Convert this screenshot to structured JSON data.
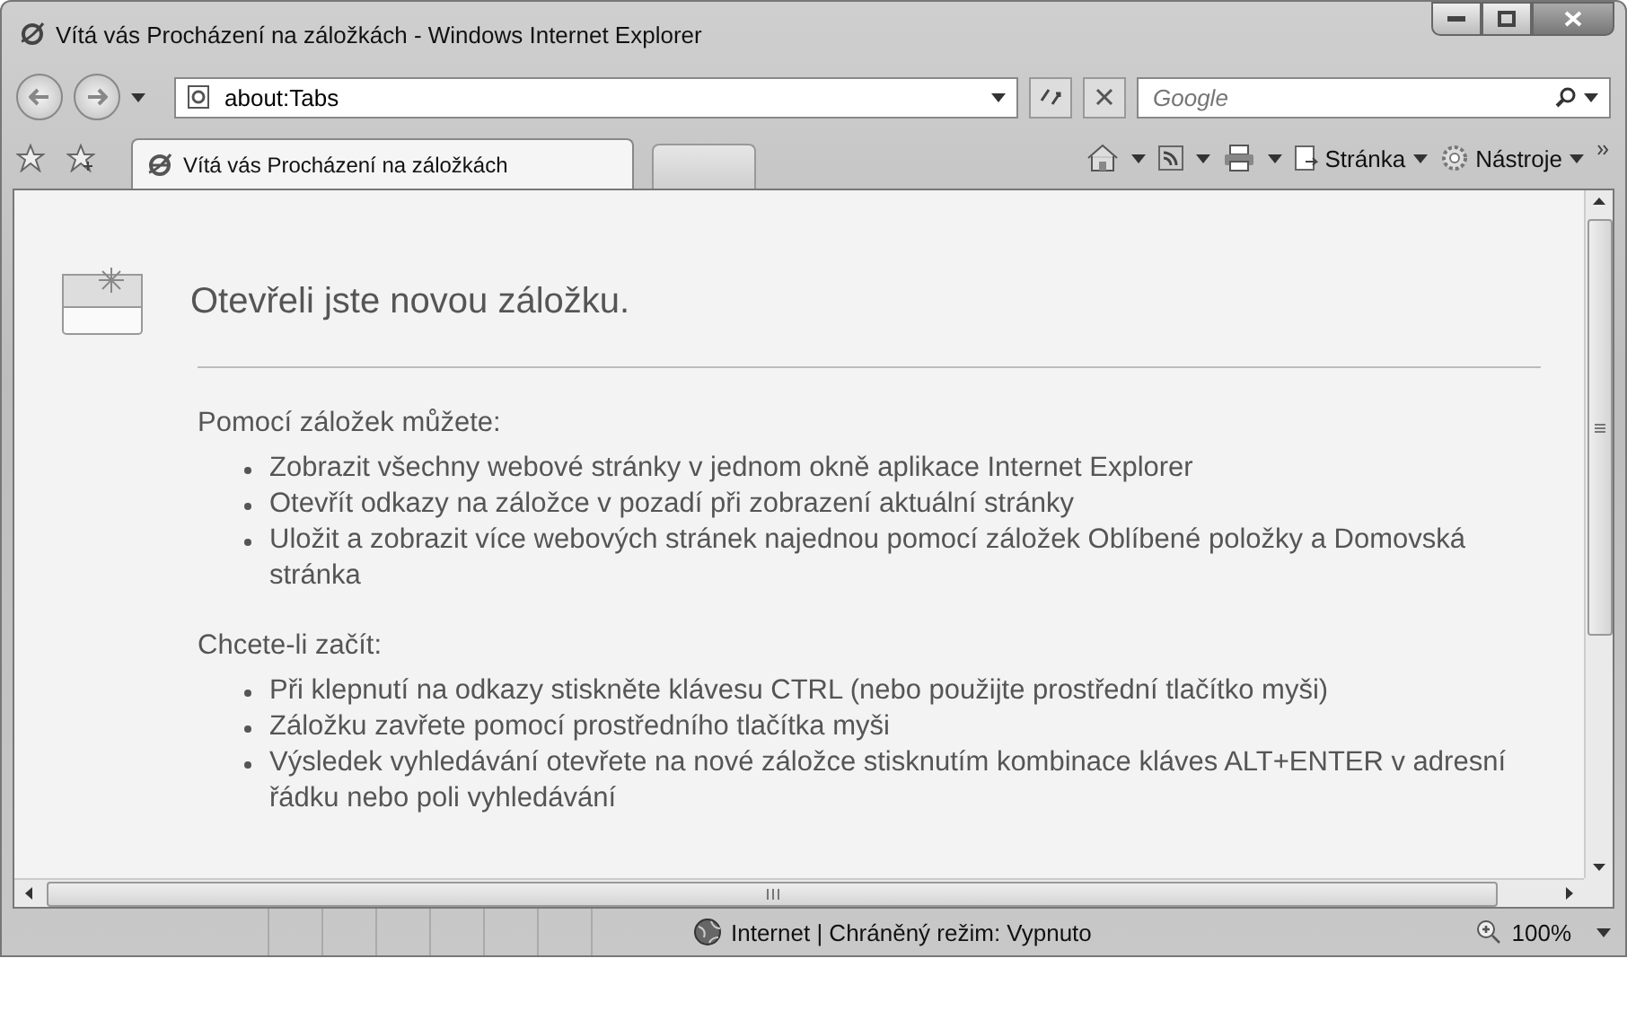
{
  "window": {
    "title": "Vítá vás Procházení na záložkách - Windows Internet Explorer"
  },
  "address_bar": {
    "value": "about:Tabs"
  },
  "search": {
    "placeholder": "Google"
  },
  "tabs": [
    {
      "label": "Vítá vás Procházení na záložkách",
      "selected": true
    }
  ],
  "command_bar": {
    "page_menu": "Stránka",
    "tools_menu": "Nástroje"
  },
  "page": {
    "heading": "Otevřeli jste novou záložku.",
    "sections": [
      {
        "title": "Pomocí záložek můžete:",
        "items": [
          "Zobrazit všechny webové stránky v jednom okně aplikace Internet Explorer",
          "Otevřít odkazy na záložce v pozadí při zobrazení aktuální stránky",
          "Uložit a zobrazit více webových stránek najednou pomocí záložek Oblíbené položky a Domovská stránka"
        ]
      },
      {
        "title": "Chcete-li začít:",
        "items": [
          "Při klepnutí na odkazy stiskněte klávesu CTRL (nebo použijte prostřední tlačítko myši)",
          "Záložku zavřete pomocí prostředního tlačítka myši",
          "Výsledek vyhledávání otevřete na nové záložce stisknutím kombinace kláves ALT+ENTER v adresní řádku nebo poli vyhledávání"
        ]
      }
    ]
  },
  "status_bar": {
    "zone": "Internet | Chráněný režim: Vypnuto",
    "zoom": "100%"
  }
}
